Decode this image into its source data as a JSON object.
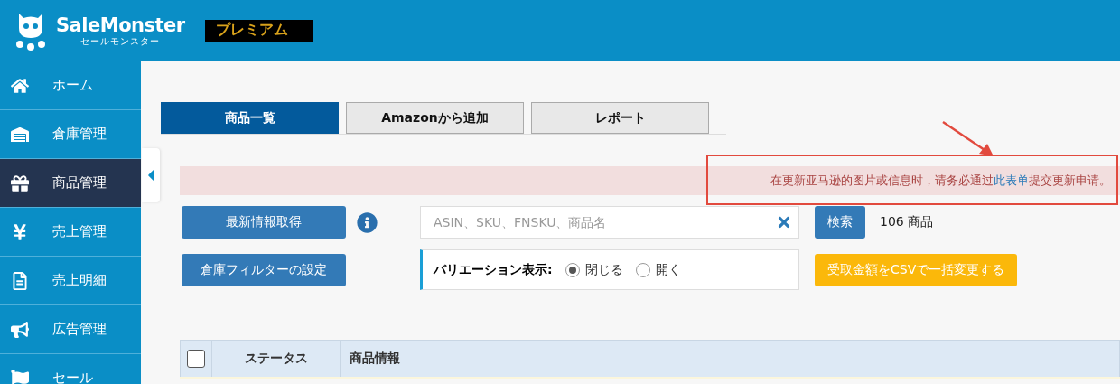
{
  "header": {
    "logo_text": "SaleMonster",
    "logo_subtext": "セールモンスター",
    "plan_badge": "プレミアム"
  },
  "sidebar": {
    "items": [
      {
        "label": "ホーム",
        "selected": false
      },
      {
        "label": "倉庫管理",
        "selected": false
      },
      {
        "label": "商品管理",
        "selected": true
      },
      {
        "label": "売上管理",
        "selected": false
      },
      {
        "label": "売上明細",
        "selected": false
      },
      {
        "label": "広告管理",
        "selected": false
      },
      {
        "label": "セール",
        "selected": false
      }
    ]
  },
  "tabs": [
    {
      "label": "商品一覧",
      "selected": true
    },
    {
      "label": "Amazonから追加",
      "selected": false
    },
    {
      "label": "レポート",
      "selected": false
    }
  ],
  "notice": {
    "before": "在更新亚马逊的图片或信息时，请务必通过",
    "link": "此表单",
    "after": "提交更新申请。"
  },
  "actions": {
    "refresh_button": "最新情報取得",
    "search": {
      "placeholder": "ASIN、SKU、FNSKU、商品名"
    },
    "search_button": "検索",
    "result_count": "106 商品",
    "filter_button": "倉庫フィルターの設定",
    "csv_button": "受取金額をCSVで一括変更する"
  },
  "variation": {
    "label": "バリエーション表示:",
    "options": [
      {
        "label": "閉じる",
        "selected": true
      },
      {
        "label": "開く",
        "selected": false
      }
    ]
  },
  "table": {
    "select_all": {
      "checked": false
    },
    "columns": [
      {
        "label": "ステータス"
      },
      {
        "label": "商品情報"
      }
    ]
  }
}
